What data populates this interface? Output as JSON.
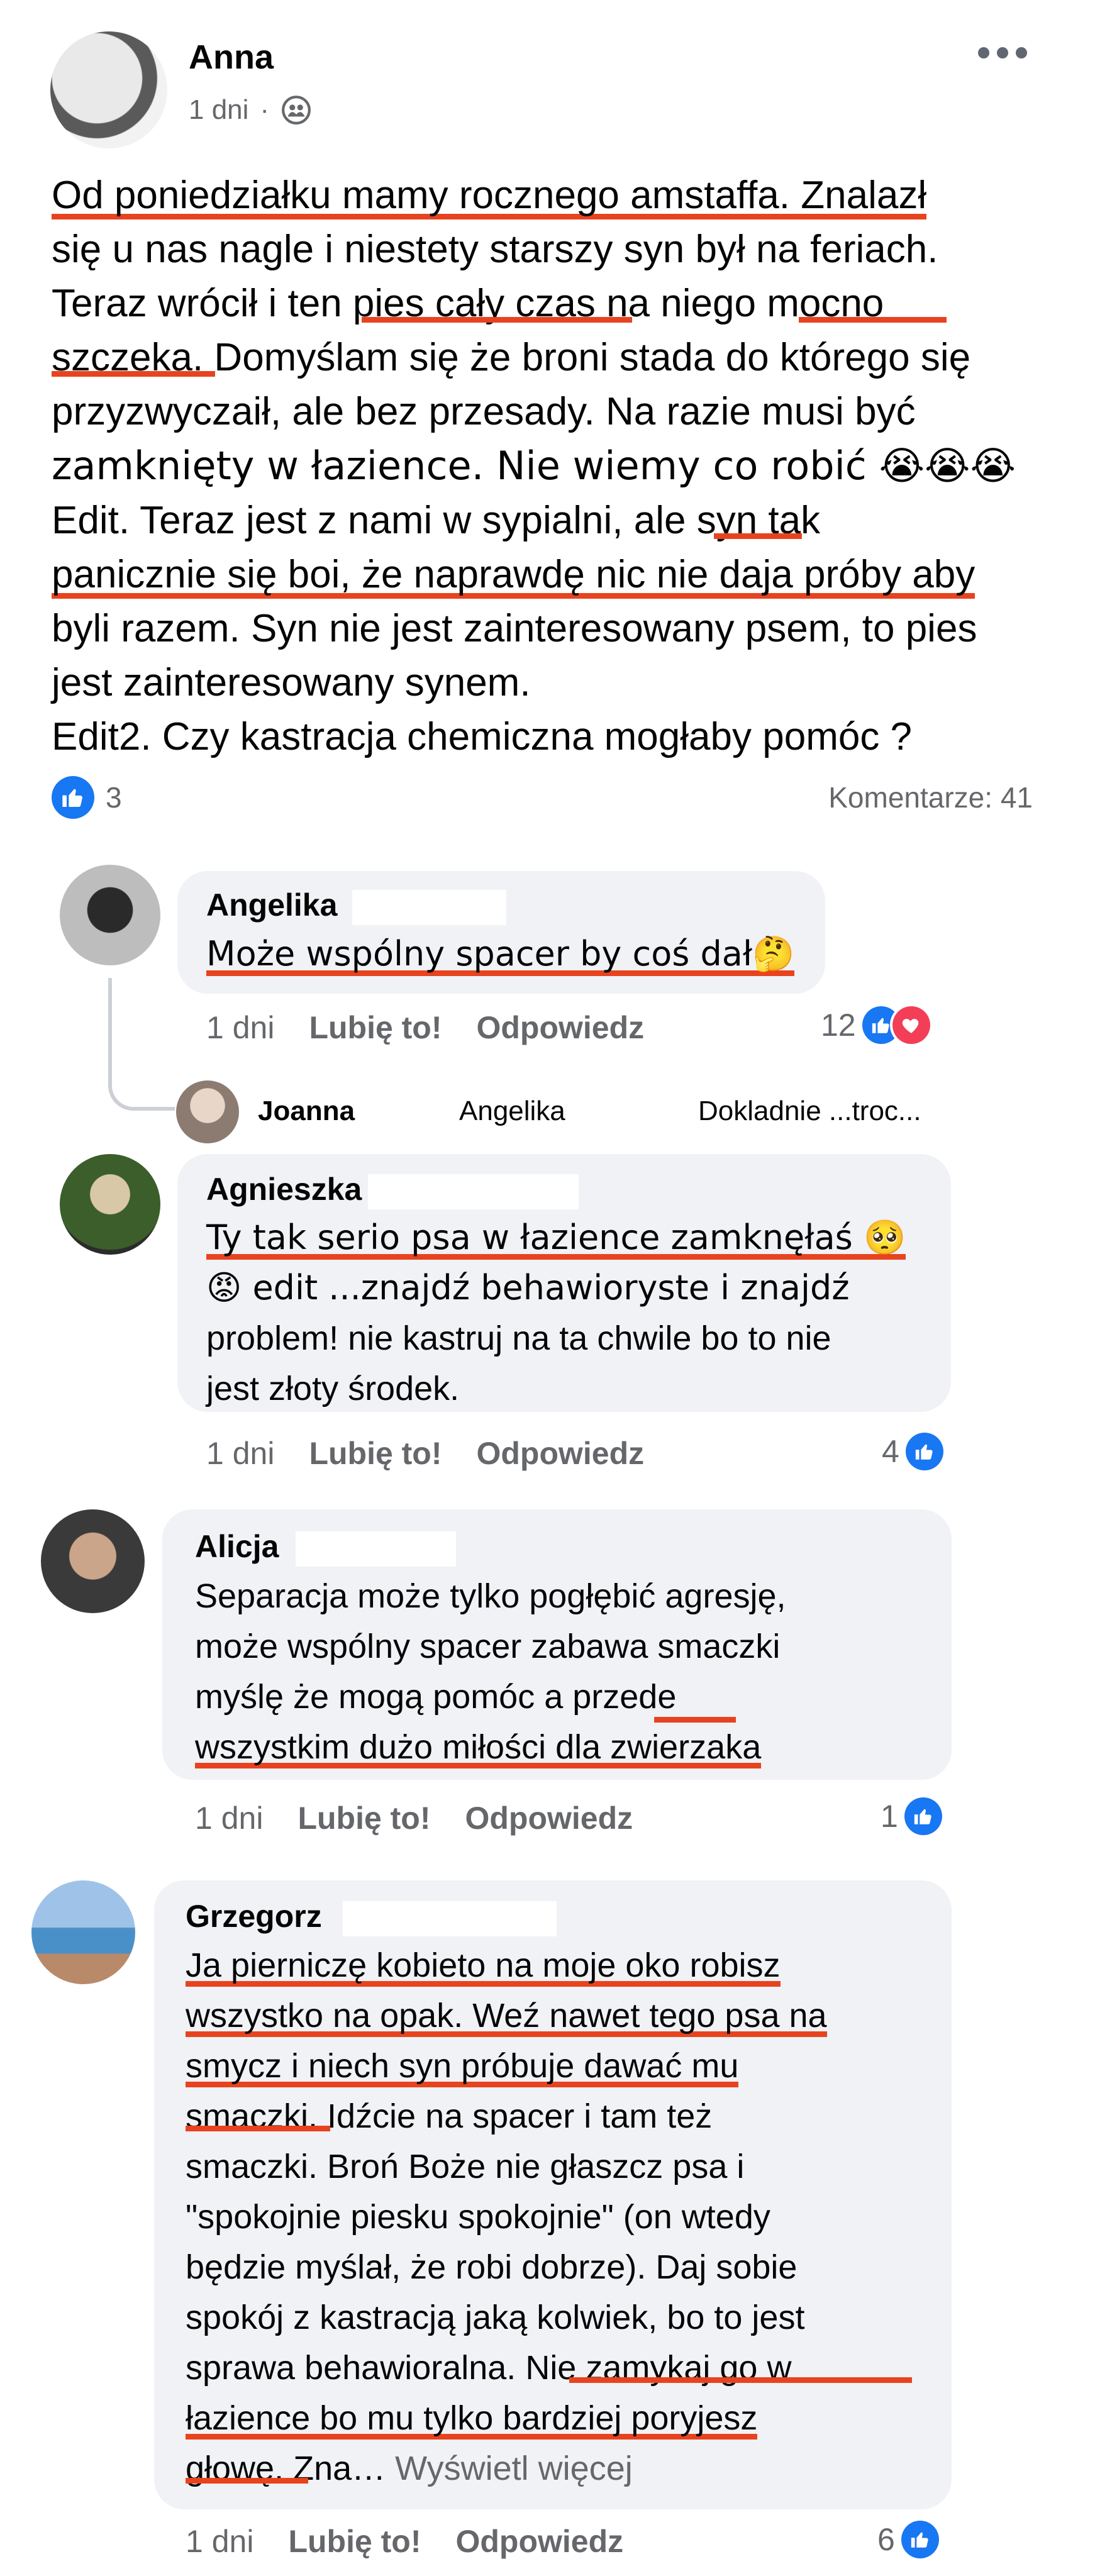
{
  "post": {
    "author": "Anna",
    "time": "1 dni",
    "separator": "·",
    "lines": [
      "Od poniedziałku mamy rocznego amstaffa. Znalazł",
      "się u nas nagle i niestety starszy syn był na feriach.",
      "Teraz wrócił i ten pies cały czas na niego mocno",
      "szczeka. Domyślam się że broni stada do którego się",
      "przyzwyczaił, ale bez przesady. Na razie musi być",
      "zamknięty w łazience. Nie wiemy co robić 😭😭😭",
      "Edit. Teraz jest z nami w sypialni, ale syn tak",
      "panicznie się boi, że naprawdę nic nie daja próby aby",
      "byli razem. Syn nie jest zainteresowany psem, to pies",
      "jest zainteresowany synem.",
      "Edit2. Czy kastracja chemiczna mogłaby pomóc ?"
    ],
    "like_count": "3",
    "comments_count": "Komentarze: 41"
  },
  "comments": [
    {
      "name": "Angelika",
      "lines": [
        "Może wspólny spacer by coś dał🤔"
      ],
      "time": "1 dni",
      "like": "Lubię to!",
      "reply": "Odpowiedz",
      "reactions": "12",
      "reply_preview": {
        "name": "Joanna",
        "mention": "Angelika",
        "snippet": "Dokladnie ...troc..."
      }
    },
    {
      "name": "Agnieszka",
      "lines": [
        "Ty tak serio psa w łazience zamknęłaś 🥺",
        "😡 edit ...znajdź behawioryste i znajdź",
        "problem! nie kastruj na ta chwile bo to nie",
        "jest złoty środek."
      ],
      "time": "1 dni",
      "like": "Lubię to!",
      "reply": "Odpowiedz",
      "reactions": "4"
    },
    {
      "name": "Alicja",
      "lines": [
        "Separacja może tylko pogłębić agresję,",
        "może wspólny spacer zabawa smaczki",
        "myślę że mogą pomóc a przede",
        "wszystkim dużo miłości dla zwierzaka"
      ],
      "time": "1 dni",
      "like": "Lubię to!",
      "reply": "Odpowiedz",
      "reactions": "1"
    },
    {
      "name": "Grzegorz",
      "lines": [
        "Ja pierniczę kobieto na moje oko robisz",
        "wszystko na opak. Weź nawet tego psa na",
        "smycz i niech syn próbuje dawać mu",
        "smaczki. Idźcie na spacer i tam też",
        "smaczki. Broń Boże nie głaszcz psa i",
        "\"spokojnie piesku spokojnie\" (on wtedy",
        "będzie myślał, że robi dobrze). Daj sobie",
        "spokój z kastracją jaką kolwiek, bo to jest",
        "sprawa behawioralna. Nie zamykaj go w",
        "łazience bo mu tylko bardziej poryjesz",
        "głowę. Zna… "
      ],
      "see_more": "Wyświetl więcej",
      "time": "1 dni",
      "like": "Lubię to!",
      "reply": "Odpowiedz",
      "reactions": "6"
    }
  ],
  "icons": {
    "more": "more-dots-icon",
    "audience": "friends-icon",
    "like": "thumbs-up-icon",
    "love": "heart-icon"
  },
  "colors": {
    "like_blue": "#1877f2",
    "love_red": "#f33e58",
    "underline_red": "#e8431f",
    "bubble_grey": "#f0f2f5"
  }
}
